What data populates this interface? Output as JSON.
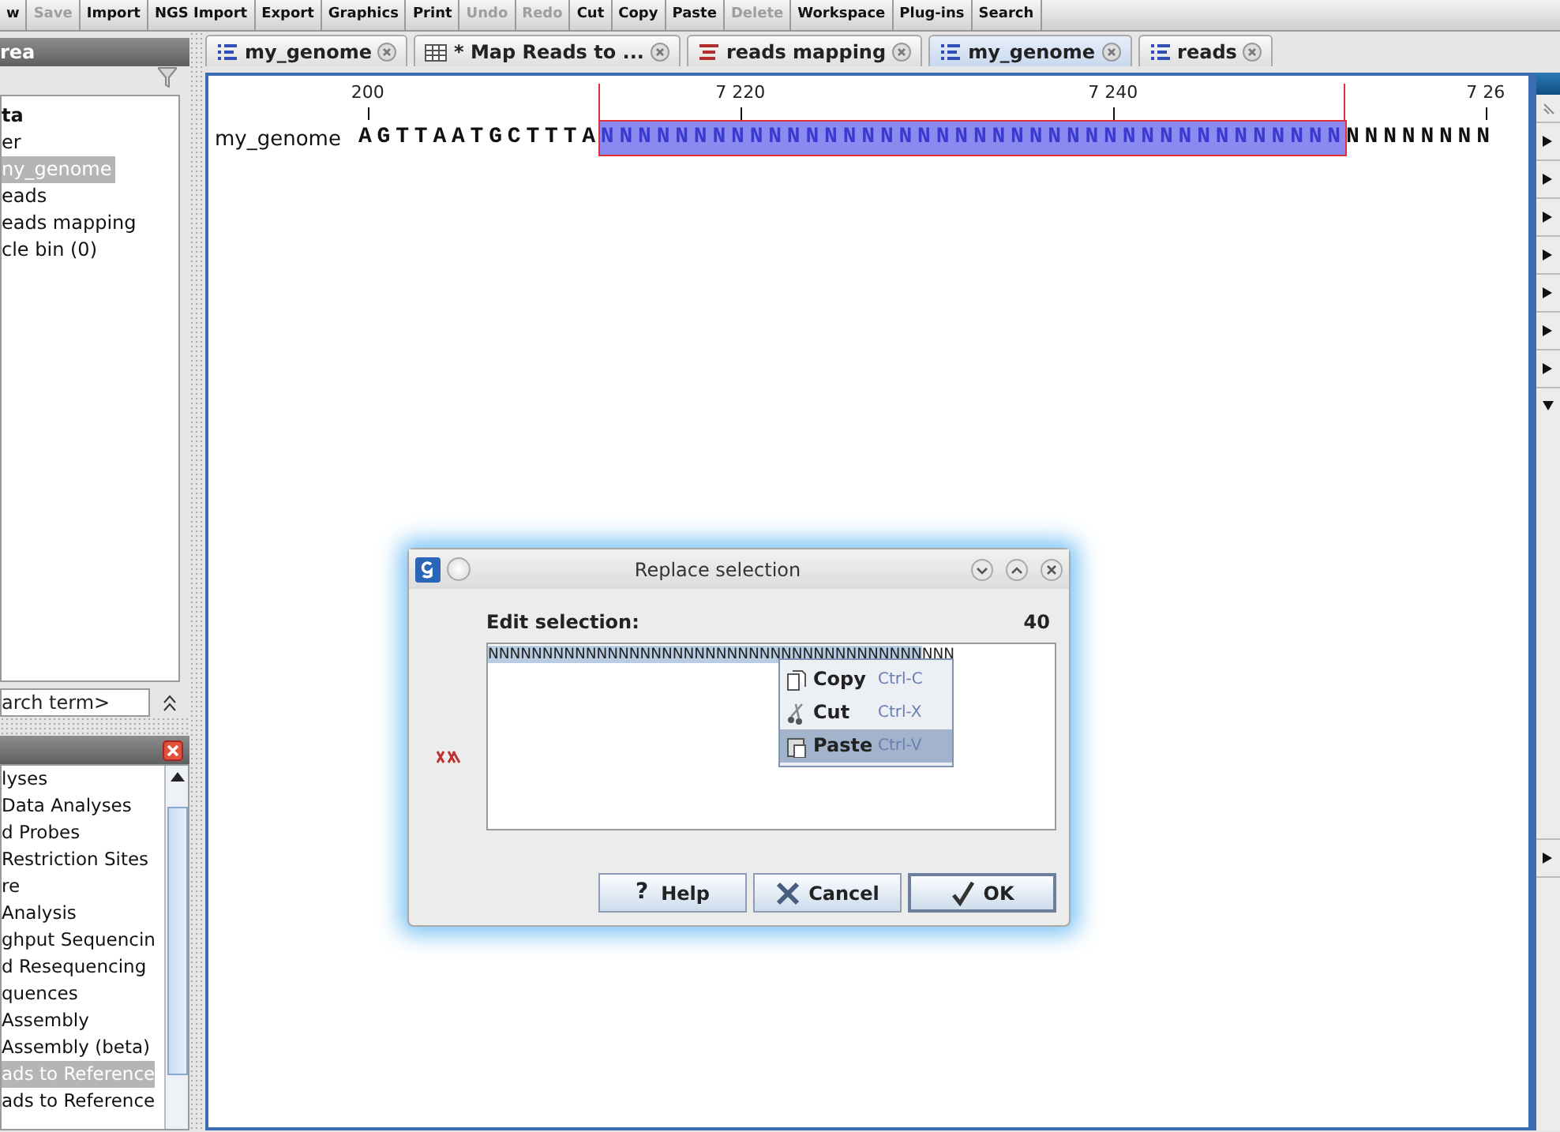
{
  "toolbar": {
    "buttons": [
      {
        "label": "w",
        "disabled": false
      },
      {
        "label": "Save",
        "disabled": true
      },
      {
        "label": "Import",
        "disabled": false
      },
      {
        "label": "NGS Import",
        "disabled": false
      },
      {
        "label": "Export",
        "disabled": false
      },
      {
        "label": "Graphics",
        "disabled": false
      },
      {
        "label": "Print",
        "disabled": false
      },
      {
        "label": "Undo",
        "disabled": true
      },
      {
        "label": "Redo",
        "disabled": true
      },
      {
        "label": "Cut",
        "disabled": false
      },
      {
        "label": "Copy",
        "disabled": false
      },
      {
        "label": "Paste",
        "disabled": false
      },
      {
        "label": "Delete",
        "disabled": true
      },
      {
        "label": "Workspace",
        "disabled": false
      },
      {
        "label": "Plug-ins",
        "disabled": false
      },
      {
        "label": "Search",
        "disabled": false
      }
    ]
  },
  "navigation": {
    "title": "rea",
    "items": [
      {
        "label": "ta",
        "bold": true,
        "selected": false
      },
      {
        "label": "er",
        "bold": false,
        "selected": false
      },
      {
        "label": "ny_genome",
        "bold": false,
        "selected": true
      },
      {
        "label": "eads",
        "bold": false,
        "selected": false
      },
      {
        "label": "eads mapping",
        "bold": false,
        "selected": false
      },
      {
        "label": "cle bin (0)",
        "bold": false,
        "selected": false
      }
    ],
    "search": {
      "placeholder": "arch term>"
    }
  },
  "toolbox": {
    "items": [
      {
        "label": "lyses",
        "selected": false
      },
      {
        "label": "Data Analyses",
        "selected": false
      },
      {
        "label": "d Probes",
        "selected": false
      },
      {
        "label": " Restriction Sites",
        "selected": false
      },
      {
        "label": "re",
        "selected": false
      },
      {
        "label": "Analysis",
        "selected": false
      },
      {
        "label": "ghput Sequencin",
        "selected": false
      },
      {
        "label": "d Resequencing",
        "selected": false
      },
      {
        "label": "quences",
        "selected": false
      },
      {
        "label": "Assembly",
        "selected": false
      },
      {
        "label": "Assembly (beta)",
        "selected": false
      },
      {
        "label": "ads to Reference",
        "selected": true
      },
      {
        "label": "ads to Reference",
        "selected": false
      }
    ]
  },
  "tabs": [
    {
      "label": "my_genome",
      "kind": "sequence",
      "selected": false
    },
    {
      "label": "* Map Reads to ...",
      "kind": "table",
      "selected": false
    },
    {
      "label": "reads mapping",
      "kind": "mapping",
      "selected": false
    },
    {
      "label": "my_genome",
      "kind": "sequence",
      "selected": true
    },
    {
      "label": "reads",
      "kind": "sequence",
      "selected": false
    }
  ],
  "sequence_view": {
    "name": "my_genome",
    "ruler": [
      "200",
      "7 220",
      "7 240",
      "7 26"
    ],
    "segments": [
      {
        "text": "AGTTAATGCTTTA",
        "selected": false
      },
      {
        "text": "NNNNNNNNNNNNNNNNNNNNNNNNNNNNNNNNNNNNNNNN",
        "selected": true
      },
      {
        "text": "NNNNNNNN",
        "selected": false
      }
    ]
  },
  "side_panel": {
    "sections": [
      {
        "expanded": false
      },
      {
        "expanded": false
      },
      {
        "expanded": false
      },
      {
        "expanded": false
      },
      {
        "expanded": false
      },
      {
        "expanded": false
      },
      {
        "expanded": false
      },
      {
        "expanded": true
      },
      {
        "expanded": false
      }
    ]
  },
  "dialog": {
    "title": "Replace selection",
    "label": "Edit selection:",
    "count": "40",
    "text": [
      {
        "text": "NNNNNNNNNNNNNNNNNNNNNNNNNNNNNNNNNNNNNNNN",
        "selected": true
      },
      {
        "text": "NNN",
        "selected": false
      }
    ],
    "context_menu": [
      {
        "kind": "copy",
        "label": "Copy",
        "shortcut": "Ctrl-C",
        "selected": false
      },
      {
        "kind": "cut",
        "label": "Cut",
        "shortcut": "Ctrl-X",
        "selected": false
      },
      {
        "kind": "paste",
        "label": "Paste",
        "shortcut": "Ctrl-V",
        "selected": true
      }
    ],
    "buttons": [
      {
        "kind": "help",
        "icon": "?",
        "label": "Help",
        "default": false
      },
      {
        "kind": "cancel",
        "label": "Cancel",
        "default": false
      },
      {
        "kind": "ok",
        "label": "OK",
        "default": true
      }
    ]
  }
}
